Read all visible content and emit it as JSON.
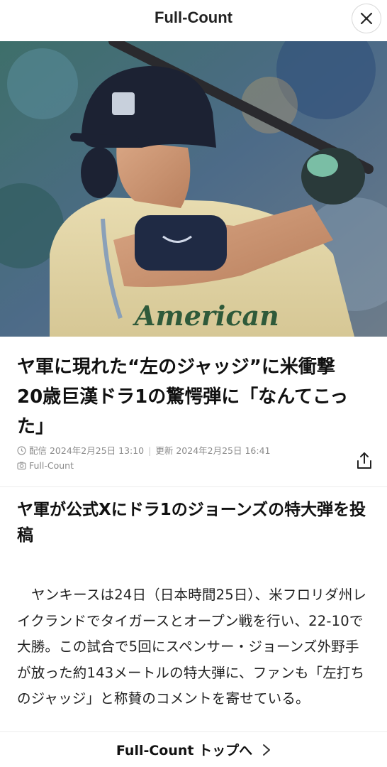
{
  "header": {
    "title": "Full-Count",
    "close_icon": "close-icon"
  },
  "hero": {
    "image": "baseball-player-batting-photo",
    "jersey_text": "American"
  },
  "article": {
    "headline": "ヤ軍に現れた“左のジャッジ”に米衝撃　20歳巨漢ドラ1の驚愕弾に「なんてこった」",
    "published_label": "配信 2024年2月25日 13:10",
    "updated_label": "更新 2024年2月25日 16:41",
    "source": "Full-Count",
    "share_icon": "share-icon",
    "subheading": "ヤ軍が公式Xにドラ1のジョーンズの特大弾を投稿",
    "body": "ヤンキースは24日（日本時間25日）、米フロリダ州レイクランドでタイガースとオープン戦を行い、22-10で大勝。この試合で5回にスペンサー・ジョーンズ外野手が放った約143メートルの特大弾に、ファンも「左打ちのジャッジ」と称賛のコメントを寄せている。"
  },
  "footer": {
    "link_label": "Full-Count トップへ",
    "arrow_icon": "chevron-right-icon"
  }
}
